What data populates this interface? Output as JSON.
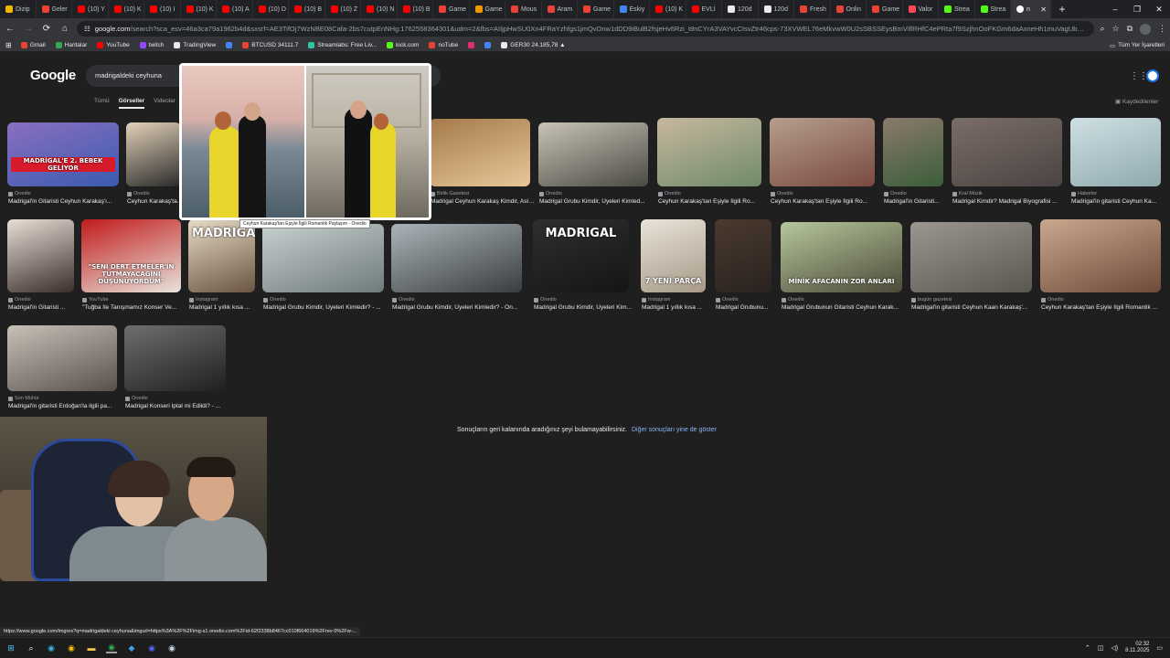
{
  "browser": {
    "tabs": [
      {
        "label": "Dizip",
        "color": "#f2b705"
      },
      {
        "label": "Geler",
        "color": "#ea4335"
      },
      {
        "label": "(10) Y",
        "color": "#ff0000"
      },
      {
        "label": "(10) K",
        "color": "#ff0000"
      },
      {
        "label": "(10) I",
        "color": "#ff0000"
      },
      {
        "label": "(10) K",
        "color": "#ff0000"
      },
      {
        "label": "(10) A",
        "color": "#ff0000"
      },
      {
        "label": "(10) D",
        "color": "#ff0000"
      },
      {
        "label": "(10) B",
        "color": "#ff0000"
      },
      {
        "label": "(10) Z",
        "color": "#ff0000"
      },
      {
        "label": "(10) N",
        "color": "#ff0000"
      },
      {
        "label": "(10) B",
        "color": "#ff0000"
      },
      {
        "label": "Game",
        "color": "#ea4335"
      },
      {
        "label": "Game",
        "color": "#f29900"
      },
      {
        "label": "Mous",
        "color": "#ea4335"
      },
      {
        "label": "Aram",
        "color": "#ea4335"
      },
      {
        "label": "Game",
        "color": "#ea4335"
      },
      {
        "label": "Eskiy",
        "color": "#4285f4"
      },
      {
        "label": "(10) K",
        "color": "#ff0000"
      },
      {
        "label": "EVLİ",
        "color": "#ff0000"
      },
      {
        "label": "120d",
        "color": "#e8eaed"
      },
      {
        "label": "120d",
        "color": "#e8eaed"
      },
      {
        "label": "Fresh",
        "color": "#ea4335"
      },
      {
        "label": "Onlin",
        "color": "#ea4335"
      },
      {
        "label": "Game",
        "color": "#ea4335"
      },
      {
        "label": "Valor",
        "color": "#ff4655"
      },
      {
        "label": "Strea",
        "color": "#53fc18"
      },
      {
        "label": "Strea",
        "color": "#53fc18"
      }
    ],
    "active_tab": {
      "label": "n",
      "close": "✕"
    },
    "new_tab": "+",
    "window_controls": [
      "–",
      "❐",
      "✕"
    ],
    "url_host": "google.com",
    "url_rest": "/search?sca_esv=46a3ca79a1962b4d&sxsrf=AE3TifOj7WzNBE08Cafa-2bs7cutpEnNHg:1762558364301&udm=2&fbs=AIIjpHwSU0Xn4FRaYzhfgs1jmQvOnw1dDD9iBulB2fsjeHv6Rzi_t8nCYrA3VAYvcCIsvZtr46cps-73XVWEL76eMkvwW0U2sSBSSEysBmViflRHfC4ePRta7f9SzjhnOoFKGm6daAxneHh1muVagUbxU837zt9_g8dVPlmRbr0p82S8BH...",
    "bookmarks": [
      {
        "label": "Gmail",
        "color": "#ea4335"
      },
      {
        "label": "Haritalar",
        "color": "#34a853"
      },
      {
        "label": "YouTube",
        "color": "#ff0000"
      },
      {
        "label": "twitch",
        "color": "#9146ff"
      },
      {
        "label": "TradingView",
        "color": "#e8eaed"
      },
      {
        "label": "",
        "color": "#4285f4"
      },
      {
        "label": "BTCUSD 34111.7",
        "color": "#ea4335"
      },
      {
        "label": "Streamlabs: Free Liv...",
        "color": "#31c3a2"
      },
      {
        "label": "kick.com",
        "color": "#53fc18"
      },
      {
        "label": "noTube",
        "color": "#ea4335"
      },
      {
        "label": "",
        "color": "#e1306c"
      },
      {
        "label": "",
        "color": "#4285f4"
      },
      {
        "label": "GER30 24.185,78 ▲",
        "color": "#e8eaed"
      }
    ],
    "all_bookmarks": "Tüm Yer İşaretleri",
    "status_url": "https://www.google.com/imgres?q=madrigaldeki ceyhuna&imgurl=https%3A%2F%2Fimg-s1.onedio.com%2Fid-62f2338b8467cc010f664019%2Frev-0%2Fw-..."
  },
  "google": {
    "logo": "Google",
    "query": "madrigaldeki ceyhuna",
    "tabs": [
      "Tümü",
      "Görseller",
      "Videolar"
    ],
    "saved": "Kaydedilenler",
    "preview_caption": "Ceyhun Karakaş'tan Eşiyle İlgili Romantik Paylaşım - Onedio",
    "end_message": "Sonuçların geri kalanında aradığınız şeyi bulamayabilirsiniz.",
    "end_link": "Diğer sonuçları yine de göster",
    "results": [
      {
        "source": "Onedio",
        "title": "Madrigal'in Gitaristi Ceyhun Karakaş'ı...",
        "overlay": "MADRİGAL'E 2. BEBEK GELİYOR"
      },
      {
        "source": "Onedio",
        "title": "Ceyhun Karakaş'ta...",
        "overlay": ""
      },
      {
        "source": "Birlik Gazetesi",
        "title": "Madrigal Ceyhun Karakaş Kimdir, Asle...",
        "overlay": ""
      },
      {
        "source": "Onedio",
        "title": "Madrigal Grubu Kimdir, Üyeleri Kimled...",
        "overlay": ""
      },
      {
        "source": "Onedio",
        "title": "Ceyhun Karakaş'tan Eşiyle İlgili Ro...",
        "overlay": ""
      },
      {
        "source": "Onedio",
        "title": "Ceyhun Karakaş'tan Eşiyle İlgili Ro...",
        "overlay": ""
      },
      {
        "source": "Onedio",
        "title": "Madrigal'in Gitaristi...",
        "overlay": ""
      },
      {
        "source": "Kral Müzik",
        "title": "Madrigal Kimdir? Madrigal Biyografisi ...",
        "overlay": ""
      },
      {
        "source": "Haberler",
        "title": "Madrigal'in gitaristi Ceyhun Ka...",
        "overlay": ""
      },
      {
        "source": "Onedio",
        "title": "Madrigal'in Gitaristi ...",
        "overlay": ""
      },
      {
        "source": "YouTube",
        "title": "\"Tuğba İle Tanışmamız Konser Ve...",
        "overlay": "\"SENİ DERT ETMELER'İN TUTMAYACAĞINI DÜŞÜNÜYORDUM\""
      },
      {
        "source": "Instagram",
        "title": "Madrigal 1 yıllık kısa ...",
        "overlay": "MADRIGAL"
      },
      {
        "source": "Onedio",
        "title": "Madrigal Grubu Kimdir, Üyeleri Kimledir? - ...",
        "overlay": ""
      },
      {
        "source": "Onedio",
        "title": "Madrigal Grubu Kimdir, Üyeleri Kimledir? - On...",
        "overlay": ""
      },
      {
        "source": "Onedio",
        "title": "Madrigal Grubu Kimdir, Üyeleri Kim...",
        "overlay": "MADRIGAL"
      },
      {
        "source": "Instagram",
        "title": "Madrigal 1 yıllık kısa ...",
        "overlay": "7 YENİ PARÇA"
      },
      {
        "source": "Onedio",
        "title": "Madrigal Grubunu...",
        "overlay": ""
      },
      {
        "source": "Onedio",
        "title": "Madrigal Grubunun Gitaristi Ceyhun Karak...",
        "overlay": "MİNİK AFACANIN ZOR ANLARI"
      },
      {
        "source": "bugün gazetesi",
        "title": "Madrigal'in gitaristi Ceyhun Kaan Karakaş'...",
        "overlay": ""
      },
      {
        "source": "Onedio",
        "title": "Ceyhun Karakaş'tan Eşiyle İlgili Romantik ...",
        "overlay": ""
      },
      {
        "source": "Son Mühür",
        "title": "Madrigal'in gitaristi Erdoğan'la ilgili pa...",
        "overlay": ""
      },
      {
        "source": "Onedio",
        "title": "Madrigal Konseri İptal mi Edildi? - ...",
        "overlay": ""
      }
    ]
  },
  "taskbar": {
    "clock_time": "02:32",
    "clock_date": "8.11.2025"
  },
  "colors": {
    "link": "#8ab4f8",
    "page_bg": "#1f1f1f"
  }
}
